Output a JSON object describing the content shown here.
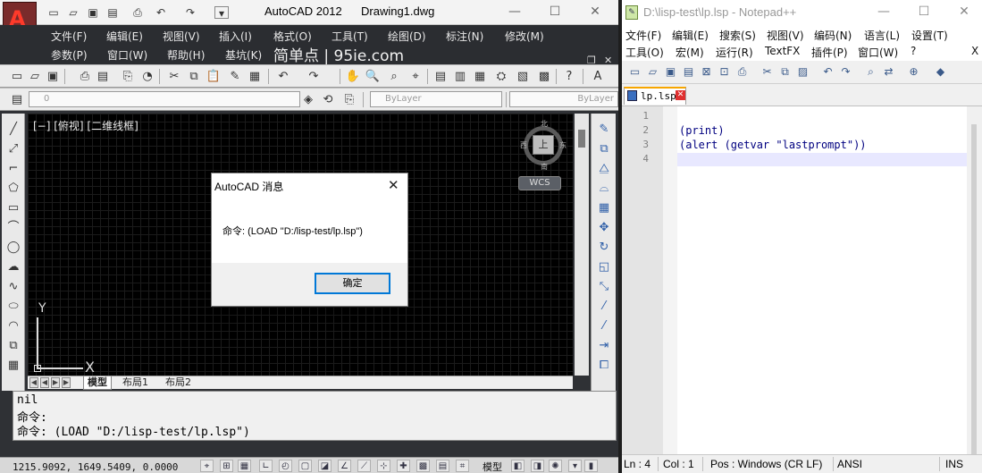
{
  "acad": {
    "app_title": "AutoCAD 2012",
    "doc_title": "Drawing1.dwg",
    "logo_letter": "A",
    "window_buttons": {
      "minimize": "—",
      "maximize": "☐",
      "close": "✕"
    },
    "qat_icons": [
      "new-icon",
      "open-icon",
      "save-icon",
      "saveas-icon",
      "print-icon",
      "undo-icon",
      "redo-icon",
      "dropdown-icon"
    ],
    "menu_row1": [
      "文件(F)",
      "编辑(E)",
      "视图(V)",
      "插入(I)",
      "格式(O)",
      "工具(T)",
      "绘图(D)",
      "标注(N)",
      "修改(M)"
    ],
    "menu_row2": [
      "参数(P)",
      "窗口(W)",
      "帮助(H)",
      "基坑(K)"
    ],
    "brand": "简单点 | 95ie.com",
    "layer_combo_text": "0",
    "bylayer1": "ByLayer",
    "bylayer2": "ByLayer",
    "viewport_label": "[−] [俯视] [二维线框]",
    "compass": {
      "north": "北",
      "south": "南",
      "east": "东",
      "west": "西",
      "face": "上"
    },
    "wcs": "WCS",
    "ucs": {
      "y": "Y",
      "x": "X"
    },
    "layout_tabs": [
      "模型",
      "布局1",
      "布局2"
    ],
    "command_lines": [
      "nil",
      "命令:",
      "命令: (LOAD \"D:/lisp-test/lp.lsp\")"
    ],
    "coords": "1215.9092, 1649.5409, 0.0000",
    "status_model": "模型"
  },
  "dialog": {
    "title": "AutoCAD 消息",
    "close": "✕",
    "message": "命令: (LOAD \"D:/lisp-test/lp.lsp\")",
    "ok_label": "确定"
  },
  "npp": {
    "title": "D:\\lisp-test\\lp.lsp - Notepad++",
    "window_buttons": {
      "minimize": "—",
      "maximize": "☐",
      "close": "✕"
    },
    "menu_row1": [
      "文件(F)",
      "编辑(E)",
      "搜索(S)",
      "视图(V)",
      "编码(N)",
      "语言(L)",
      "设置(T)"
    ],
    "menu_row2": [
      "工具(O)",
      "宏(M)",
      "运行(R)",
      "TextFX",
      "插件(P)",
      "窗口(W)",
      "?"
    ],
    "menu_close": "X",
    "file_tab": "lp.lsp",
    "line_numbers": [
      "1",
      "2",
      "3",
      "4"
    ],
    "code_lines": [
      "",
      "(print)",
      "(alert (getvar \"lastprompt\"))",
      ""
    ],
    "status": {
      "ln": "Ln : 4",
      "col": "Col : 1",
      "pos": "Pos : Windows (CR LF)",
      "enc": "ANSI",
      "ins": "INS"
    }
  }
}
